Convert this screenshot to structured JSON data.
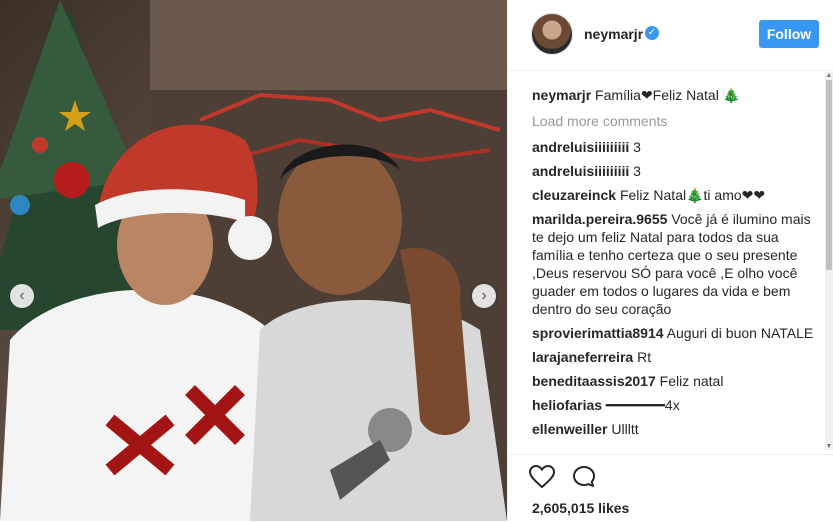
{
  "post": {
    "username": "neymarjr",
    "follow_label": "Follow",
    "likes": "2,605,015 likes"
  },
  "caption": {
    "user": "neymarjr",
    "text": "Família❤Feliz Natal 🎄"
  },
  "load_more": "Load more comments",
  "comments": [
    {
      "user": "andreluisiiiiiiiii",
      "text": "3"
    },
    {
      "user": "andreluisiiiiiiiii",
      "text": "3"
    },
    {
      "user": "cleuzareinck",
      "text": "Feliz Natal🎄ti amo❤❤"
    },
    {
      "user": "marilda.pereira.9655",
      "text": "Você já é ilumino mais te dejo um feliz Natal para todos da sua família e tenho certeza que o seu presente ,Deus reservou SÓ para você ,E olho você guader em todos o lugares da vida e bem dentro do seu coração"
    },
    {
      "user": "sprovierimattia8914",
      "text": "Auguri di buon NATALE"
    },
    {
      "user": "larajaneferreira",
      "text": "Rt"
    },
    {
      "user": "beneditaassis2017",
      "text": "Feliz natal"
    },
    {
      "user": "heliofarias",
      "text": "━━━━━━━4x"
    },
    {
      "user": "ellenweiller",
      "text": "Ullltt"
    }
  ],
  "icons": {
    "like": "heart-icon",
    "comment": "comment-icon",
    "prev": "chevron-left-icon",
    "next": "chevron-right-icon"
  },
  "colors": {
    "accent": "#3897f0"
  }
}
